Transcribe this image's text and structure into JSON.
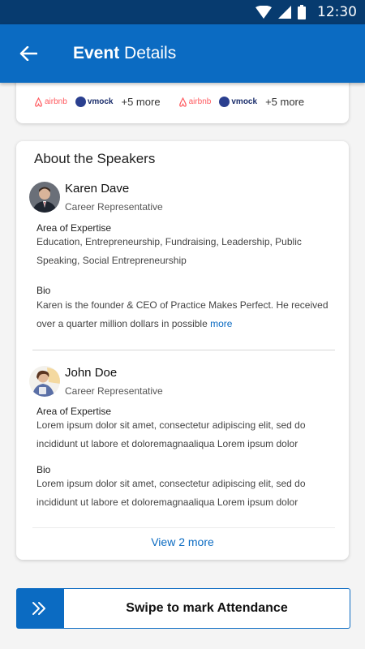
{
  "status_bar": {
    "time": "12:30"
  },
  "app_bar": {
    "title_bold": "Event",
    "title_rest": "Details"
  },
  "companies": [
    {
      "name": "airbnb"
    },
    {
      "name": "vmock"
    },
    {
      "more": "+5 more"
    },
    {
      "name": "airbnb"
    },
    {
      "name": "vmock"
    },
    {
      "more": "+5 more"
    }
  ],
  "speakers_section": {
    "title": "About the Speakers",
    "speakers": [
      {
        "name": "Karen Dave",
        "role": "Career Representative",
        "expertise_label": "Area of Expertise",
        "expertise_line1": "Education, Entrepreneurship, Fundraising, Leadership,  Public",
        "expertise_line2": "Speaking, Social Entrepreneurship",
        "bio_label": "Bio",
        "bio_line1": "Karen is the founder & CEO of Practice Makes Perfect. He received",
        "bio_line2": "over a quarter million dollars in possible",
        "more": "more"
      },
      {
        "name": "John Doe",
        "role": "Career Representative",
        "expertise_label": "Area of Expertise",
        "expertise_line1": "Lorem ipsum dolor sit amet, consectetur adipiscing elit, sed do",
        "expertise_line2": "incididunt ut labore et doloremagnaaliqua Lorem ipsum dolor",
        "bio_label": "Bio",
        "bio_line1": "Lorem ipsum dolor sit amet, consectetur adipiscing elit, sed do",
        "bio_line2": "incididunt ut labore et doloremagnaaliqua Lorem ipsum dolor"
      }
    ],
    "view_more": "View 2 more"
  },
  "swipe": {
    "label": "Swipe to mark Attendance"
  },
  "colors": {
    "primary": "#0b6bc2",
    "status_bar": "#073b6f",
    "airbnb": "#ff5a5f"
  }
}
